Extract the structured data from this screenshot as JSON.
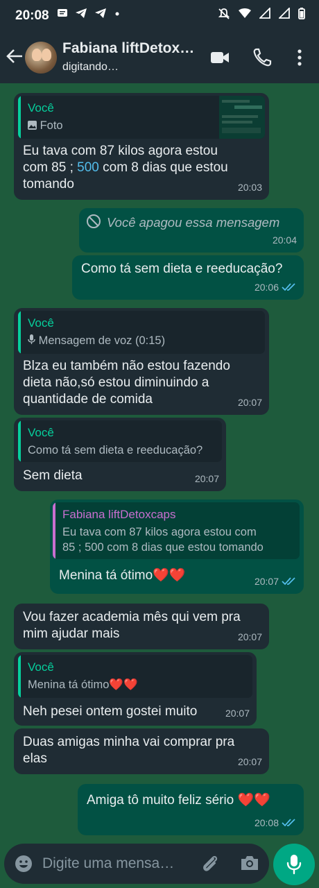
{
  "status_bar": {
    "time": "20:08"
  },
  "header": {
    "contact_name": "Fabiana liftDetox…",
    "contact_status": "digitando…"
  },
  "messages": [
    {
      "dir": "in",
      "quote_author": "Você",
      "quote_text": "Foto",
      "quote_type": "photo",
      "text_lines": [
        "Eu tava com 87 kilos agora estou",
        "com 85 ; 500 com 8 dias que estou",
        "tomando"
      ],
      "time": "20:03"
    },
    {
      "dir": "out",
      "deleted": true,
      "text": "Você apagou essa mensagem",
      "time": "20:04"
    },
    {
      "dir": "out",
      "text": "Como tá sem dieta e reeducação?",
      "time": "20:06",
      "status": "read"
    },
    {
      "dir": "in",
      "quote_author": "Você",
      "quote_text": "Mensagem de voz (0:15)",
      "quote_type": "voice",
      "text_lines": [
        "Blza eu também não estou fazendo",
        "dieta não,só estou diminuindo a",
        "quantidade de comida"
      ],
      "time": "20:07"
    },
    {
      "dir": "in",
      "quote_author": "Você",
      "quote_text": "Como tá sem dieta e reeducação?",
      "text": "Sem dieta",
      "time": "20:07"
    },
    {
      "dir": "out",
      "quote_author": "Fabiana liftDetoxcaps",
      "quote_text_lines": [
        "Eu tava com 87 kilos agora estou com",
        "85 ; 500 com 8 dias que estou tomando"
      ],
      "text": "Menina tá ótimo❤️❤️",
      "time": "20:07",
      "status": "read"
    },
    {
      "dir": "in",
      "text_lines": [
        "Vou fazer academia mês qui vem pra",
        "mim ajudar mais"
      ],
      "time": "20:07"
    },
    {
      "dir": "in",
      "quote_author": "Você",
      "quote_text": "Menina tá ótimo❤️❤️",
      "text": "Neh pesei ontem gostei muito",
      "time": "20:07"
    },
    {
      "dir": "in",
      "text_lines": [
        "Duas amigas minha vai comprar pra",
        "elas"
      ],
      "time": "20:07"
    },
    {
      "dir": "out",
      "text": "Amiga tô muito feliz sério ❤️❤️",
      "time": "20:08",
      "status": "read"
    }
  ],
  "composer": {
    "placeholder": "Digite uma mensa…"
  },
  "colors": {
    "accent": "#00a884",
    "quote_name_you": "#06cf9c",
    "quote_name_contact": "#c86fd0",
    "tick_read": "#53bdeb",
    "link_number": "#53bdeb"
  }
}
